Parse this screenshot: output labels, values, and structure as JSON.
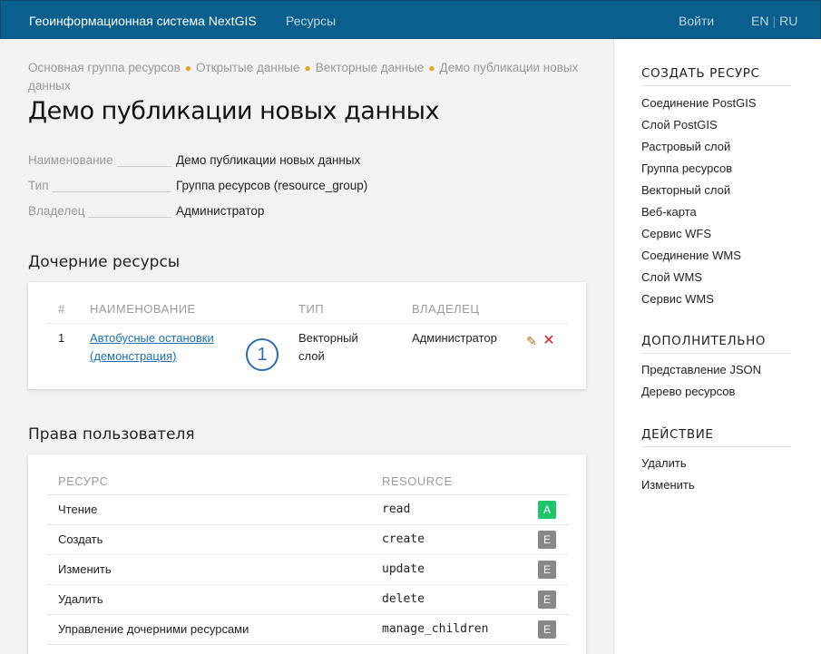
{
  "topbar": {
    "brand": "Геоинформационная система NextGIS",
    "nav_resources": "Ресурсы",
    "login": "Войти",
    "lang_en": "EN",
    "lang_ru": "RU"
  },
  "breadcrumb": {
    "items": [
      "Основная группа ресурсов",
      "Открытые данные",
      "Векторные данные",
      "Демо публикации новых данных"
    ]
  },
  "page_title": "Демо публикации новых данных",
  "properties": [
    {
      "key": "Наименование",
      "value": "Демо публикации новых данных"
    },
    {
      "key": "Тип",
      "value": "Группа ресурсов (resource_group)"
    },
    {
      "key": "Владелец",
      "value": "Администратор"
    }
  ],
  "children": {
    "title": "Дочерние ресурсы",
    "headers": {
      "num": "#",
      "name": "НАИМЕНОВАНИЕ",
      "type": "ТИП",
      "owner": "ВЛАДЕЛЕЦ"
    },
    "rows": [
      {
        "num": "1",
        "name_line1": "Автобусные остановки",
        "name_line2": "(демонстрация)",
        "type_line1": "Векторный",
        "type_line2": "слой",
        "owner": "Администратор"
      }
    ],
    "callout": "1",
    "edit_icon": "edit-icon",
    "delete_icon": "delete-icon",
    "delete_color": "#dd2222"
  },
  "permissions": {
    "title": "Права пользователя",
    "headers": {
      "resource": "РЕСУРС",
      "code": "RESOURCE"
    },
    "rows": [
      {
        "name": "Чтение",
        "code": "read",
        "badge": "A",
        "color": "#21c36b"
      },
      {
        "name": "Создать",
        "code": "create",
        "badge": "E",
        "color": "#888888"
      },
      {
        "name": "Изменить",
        "code": "update",
        "badge": "E",
        "color": "#888888"
      },
      {
        "name": "Удалить",
        "code": "delete",
        "badge": "E",
        "color": "#888888"
      },
      {
        "name": "Управление дочерними ресурсами",
        "code": "manage_children",
        "badge": "E",
        "color": "#888888"
      }
    ]
  },
  "sidebar": {
    "create": {
      "title": "СОЗДАТЬ РЕСУРС",
      "items": [
        "Соединение PostGIS",
        "Слой PostGIS",
        "Растровый слой",
        "Группа ресурсов",
        "Векторный слой",
        "Веб-карта",
        "Сервис WFS",
        "Соединение WMS",
        "Слой WMS",
        "Сервис WMS"
      ]
    },
    "extra": {
      "title": "ДОПОЛНИТЕЛЬНО",
      "items": [
        "Представление JSON",
        "Дерево ресурсов"
      ]
    },
    "action": {
      "title": "ДЕЙСТВИЕ",
      "items": [
        "Удалить",
        "Изменить"
      ]
    }
  },
  "colors": {
    "topbar": "#0a5f8c",
    "accent_dot": "#f0a020",
    "link": "#1b6fb0"
  }
}
